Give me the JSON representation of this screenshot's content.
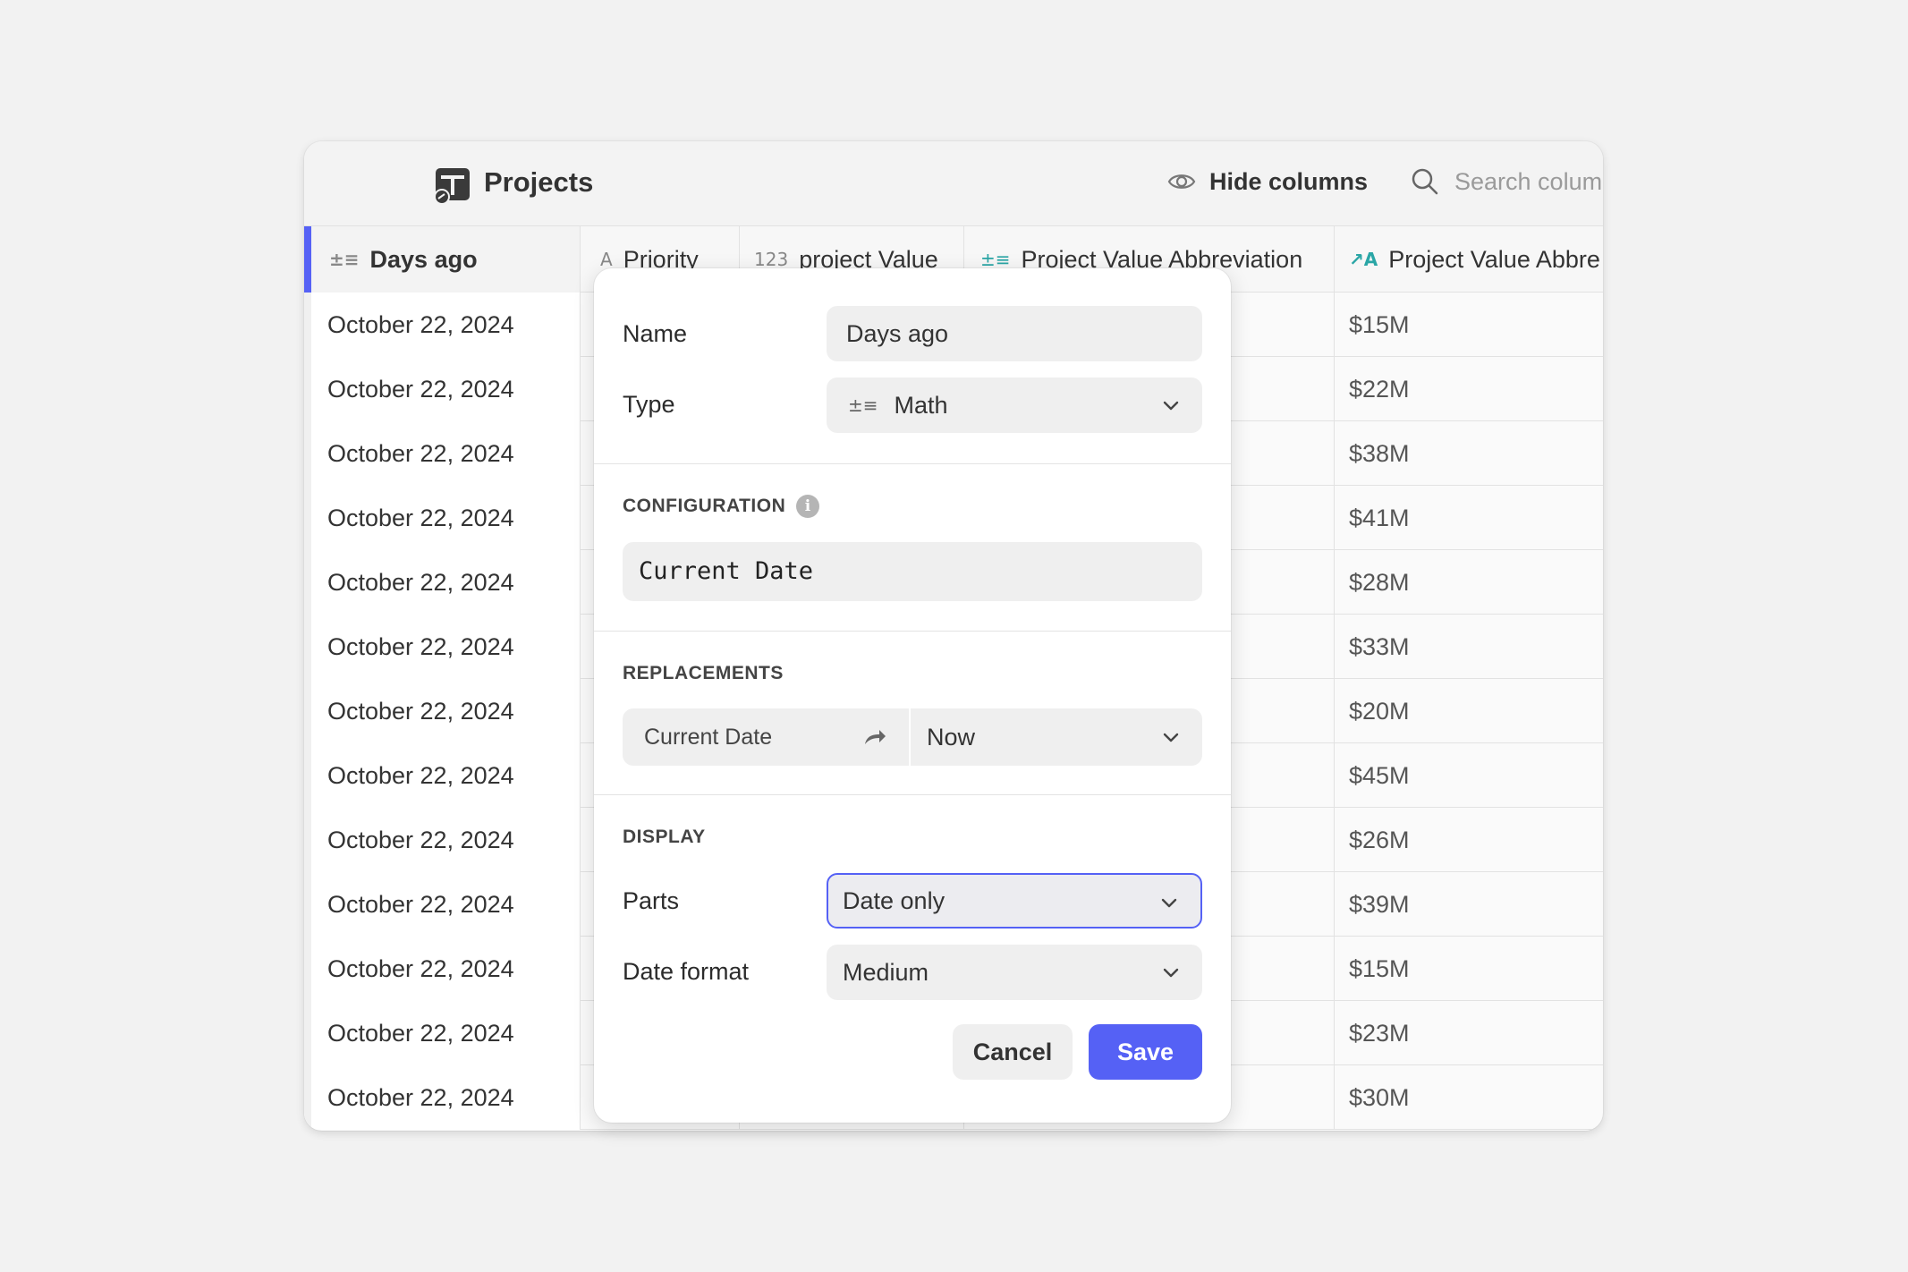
{
  "app": {
    "title": "Projects"
  },
  "toolbar": {
    "hide_columns_label": "Hide columns",
    "search_placeholder": "Search columns"
  },
  "columns": [
    {
      "label": "Days ago",
      "icon": "math-icon"
    },
    {
      "label": "Priority",
      "icon": "text-icon"
    },
    {
      "label": "project Value",
      "icon": "number-icon"
    },
    {
      "label": "Project Value Abbreviation",
      "icon": "math-icon"
    },
    {
      "label": "Project Value Abbre",
      "icon": "ai-text-icon"
    }
  ],
  "rows": [
    {
      "date": "October 22, 2024",
      "value": "$15M"
    },
    {
      "date": "October 22, 2024",
      "value": "$22M"
    },
    {
      "date": "October 22, 2024",
      "value": "$38M"
    },
    {
      "date": "October 22, 2024",
      "value": "$41M"
    },
    {
      "date": "October 22, 2024",
      "value": "$28M"
    },
    {
      "date": "October 22, 2024",
      "value": "$33M"
    },
    {
      "date": "October 22, 2024",
      "value": "$20M"
    },
    {
      "date": "October 22, 2024",
      "value": "$45M"
    },
    {
      "date": "October 22, 2024",
      "value": "$26M"
    },
    {
      "date": "October 22, 2024",
      "value": "$39M"
    },
    {
      "date": "October 22, 2024",
      "value": "$15M"
    },
    {
      "date": "October 22, 2024",
      "value": "$23M"
    },
    {
      "date": "October 22, 2024",
      "value": "$30M"
    }
  ],
  "popover": {
    "name_label": "Name",
    "name_value": "Days ago",
    "type_label": "Type",
    "type_value": "Math",
    "configuration_title": "CONFIGURATION",
    "configuration_value": "Current Date",
    "replacements_title": "REPLACEMENTS",
    "replacement_from": "Current Date",
    "replacement_to": "Now",
    "display_title": "DISPLAY",
    "parts_label": "Parts",
    "parts_value": "Date only",
    "date_format_label": "Date format",
    "date_format_value": "Medium",
    "cancel_label": "Cancel",
    "save_label": "Save"
  },
  "colors": {
    "accent": "#5561f5",
    "background": "#f2f2f2"
  }
}
